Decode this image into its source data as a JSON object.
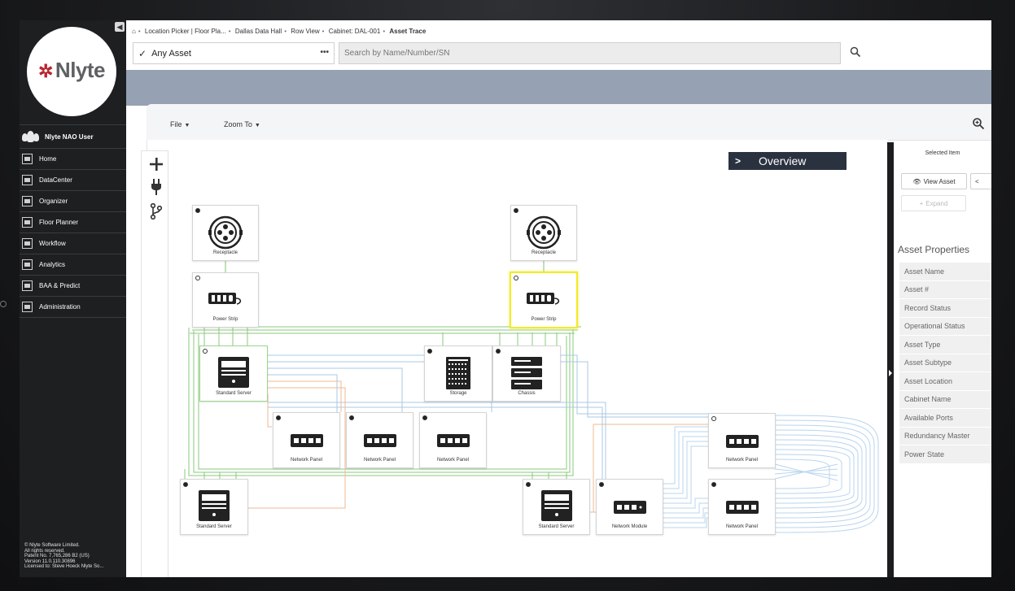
{
  "sidebar": {
    "logo": "Nlyte",
    "user": "Nlyte NAO User",
    "items": [
      {
        "label": "Home"
      },
      {
        "label": "DataCenter"
      },
      {
        "label": "Organizer"
      },
      {
        "label": "Floor Planner"
      },
      {
        "label": "Workflow"
      },
      {
        "label": "Analytics"
      },
      {
        "label": "BAA & Predict"
      },
      {
        "label": "Administration"
      }
    ],
    "footer": [
      "© Nlyte Software Limited.",
      "All rights reserved.",
      "Patent No. 7,765,286 B2 (US)",
      "Version 11.0.110.30896",
      "Licensed to: Steve Hoeck Nlyte So..."
    ]
  },
  "breadcrumb": [
    "Location Picker | Floor Pla...",
    "Dallas Data Hall",
    "Row View",
    "Cabinet: DAL-001",
    "Asset Trace"
  ],
  "filter": {
    "selected": "Any Asset",
    "search_placeholder": "Search by Name/Number/SN"
  },
  "toolbar": {
    "file": "File",
    "zoom_to": "Zoom To"
  },
  "overview": "Overview",
  "nodes": {
    "receptacle": "Receptacle",
    "power_strip": "Power Strip",
    "standard_server": "Standard Server",
    "storage": "Storage",
    "chassis": "Chassis",
    "network_panel": "Network Panel",
    "network_module": "Network Module"
  },
  "panel": {
    "title": "Selected Item",
    "view_asset": "View Asset",
    "expand": "Expand",
    "properties_title": "Asset Properties",
    "properties": [
      "Asset Name",
      "Asset #",
      "Record Status",
      "Operational Status",
      "Asset Type",
      "Asset Subtype",
      "Asset Location",
      "Cabinet Name",
      "Available Ports",
      "Redundancy Master",
      "Power State"
    ]
  },
  "colors": {
    "accent_overview": "#2a3240",
    "band": "#96a2b3",
    "selected_border": "#f2ea2a"
  }
}
